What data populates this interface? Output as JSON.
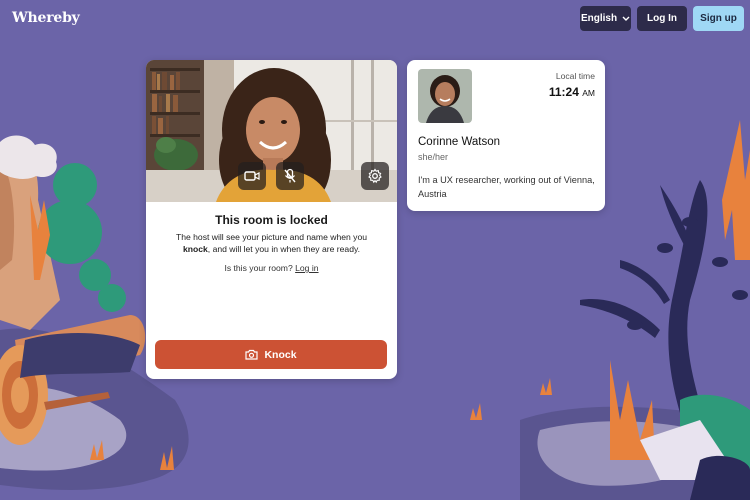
{
  "header": {
    "logo": "Whereby",
    "language_label": "English",
    "login_label": "Log In",
    "signup_label": "Sign up"
  },
  "room": {
    "title": "This room is locked",
    "desc_pre": "The host will see your picture and name when you ",
    "desc_bold": "knock",
    "desc_post": ", and will let you in when they are ready.",
    "owner_question": "Is this your room?",
    "owner_link": "Log in",
    "knock_label": "Knock"
  },
  "host": {
    "local_time_label": "Local time",
    "time": "11:24",
    "ampm": "AM",
    "name": "Corinne Watson",
    "pronouns": "she/her",
    "bio": "I'm a UX researcher, working out of Vienna, Austria"
  },
  "colors": {
    "background": "#6b64a8",
    "knock_button": "#cc5234",
    "signup_button": "#9fd8f5",
    "dark_button": "#2d2b4a"
  },
  "icons": [
    "chevron-down-icon",
    "camera-icon",
    "mic-off-icon",
    "gear-icon",
    "knock-camera-icon"
  ]
}
